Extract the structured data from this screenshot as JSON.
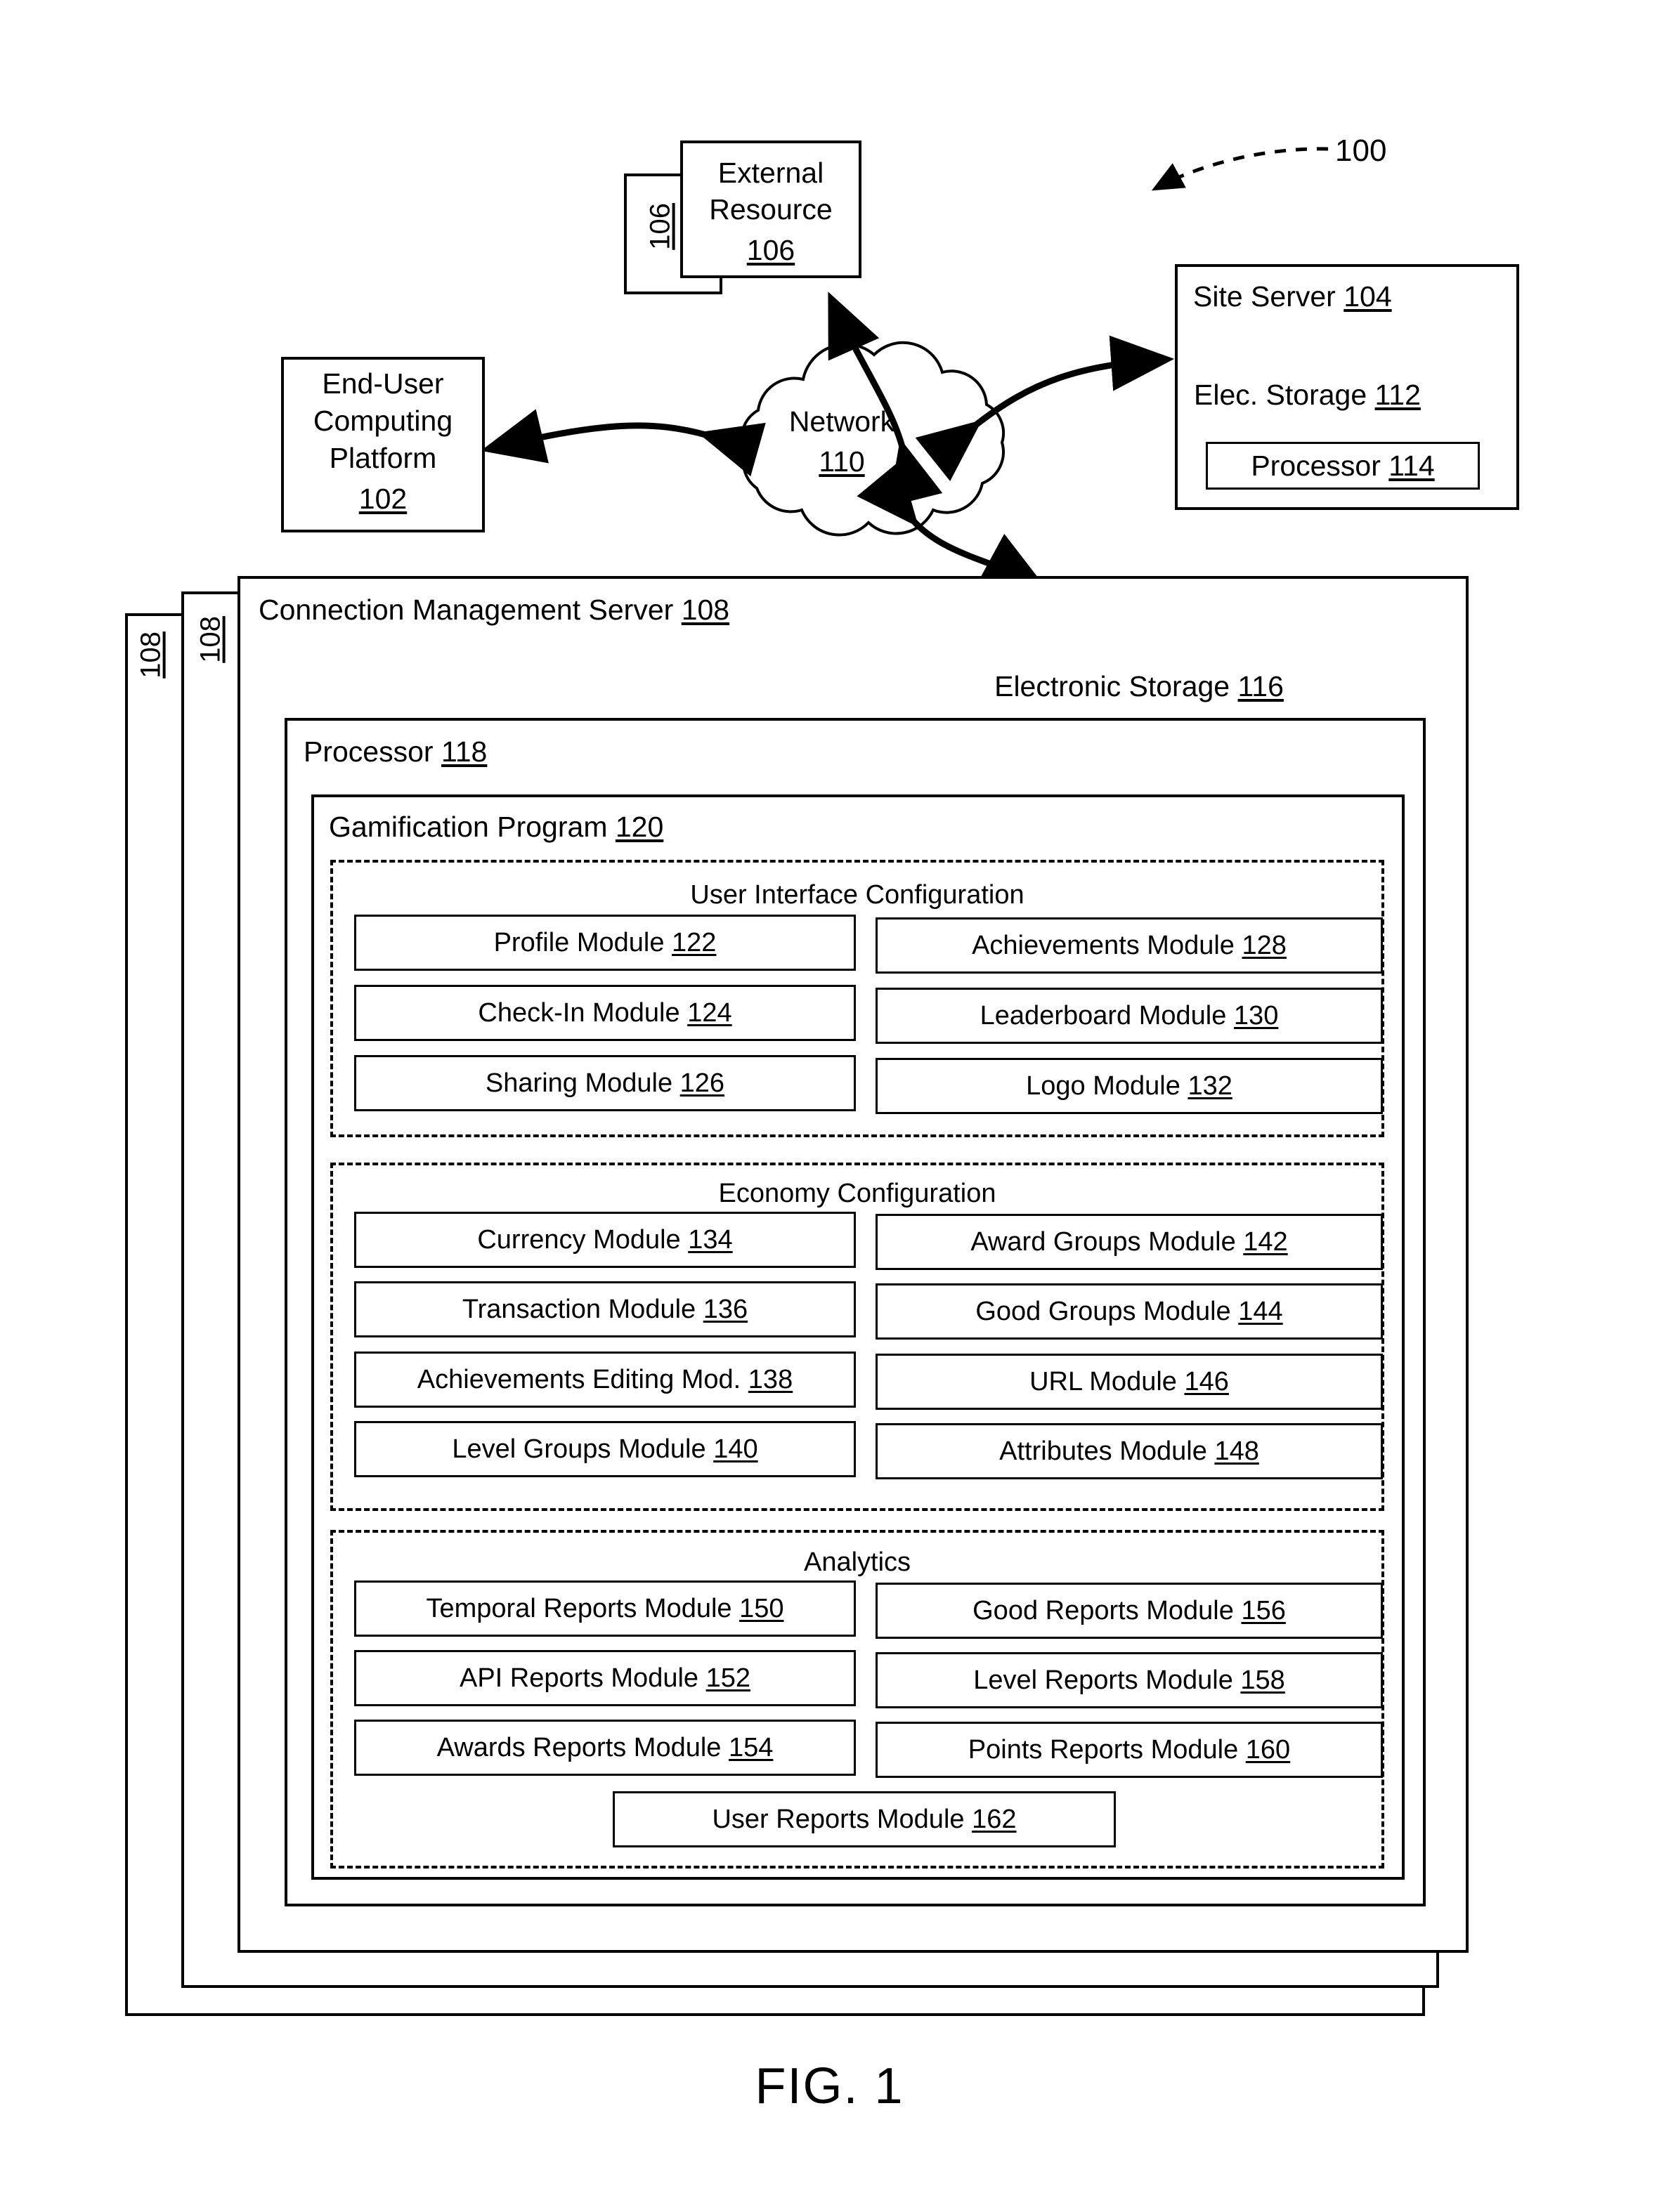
{
  "figure": {
    "caption": "FIG. 1",
    "system_ref": "100"
  },
  "nodes": {
    "external_resource": {
      "label": "External",
      "label2": "Resource",
      "ref": "106",
      "stack_ref": "106"
    },
    "end_user_platform": {
      "line1": "End-User",
      "line2": "Computing",
      "line3": "Platform",
      "ref": "102"
    },
    "network": {
      "label": "Network",
      "ref": "110"
    },
    "site_server": {
      "title": "Site Server",
      "ref": "104",
      "storage_label": "Elec. Storage",
      "storage_ref": "112",
      "processor_label": "Processor",
      "processor_ref": "114"
    },
    "connection_management_server": {
      "title": "Connection Management Server",
      "ref": "108",
      "stack_ref_1": "108",
      "stack_ref_2": "108",
      "storage_label": "Electronic Storage",
      "storage_ref": "116",
      "processor_label": "Processor",
      "processor_ref": "118",
      "program_label": "Gamification Program",
      "program_ref": "120"
    }
  },
  "sections": [
    {
      "title": "User Interface Configuration",
      "left_modules": [
        {
          "label": "Profile Module",
          "ref": "122"
        },
        {
          "label": "Check-In Module",
          "ref": "124"
        },
        {
          "label": "Sharing Module",
          "ref": "126"
        }
      ],
      "right_modules": [
        {
          "label": "Achievements Module",
          "ref": "128"
        },
        {
          "label": "Leaderboard Module",
          "ref": "130"
        },
        {
          "label": "Logo Module",
          "ref": "132"
        }
      ],
      "full_modules": []
    },
    {
      "title": "Economy Configuration",
      "left_modules": [
        {
          "label": "Currency Module",
          "ref": "134"
        },
        {
          "label": "Transaction Module",
          "ref": "136"
        },
        {
          "label": "Achievements Editing Mod.",
          "ref": "138"
        },
        {
          "label": "Level Groups Module",
          "ref": "140"
        }
      ],
      "right_modules": [
        {
          "label": "Award Groups Module",
          "ref": "142"
        },
        {
          "label": "Good Groups Module",
          "ref": "144"
        },
        {
          "label": "URL Module",
          "ref": "146"
        },
        {
          "label": "Attributes Module",
          "ref": "148"
        }
      ],
      "full_modules": []
    },
    {
      "title": "Analytics",
      "left_modules": [
        {
          "label": "Temporal Reports Module",
          "ref": "150"
        },
        {
          "label": "API Reports Module",
          "ref": "152"
        },
        {
          "label": "Awards Reports Module",
          "ref": "154"
        }
      ],
      "right_modules": [
        {
          "label": "Good Reports Module",
          "ref": "156"
        },
        {
          "label": "Level Reports Module",
          "ref": "158"
        },
        {
          "label": "Points Reports Module",
          "ref": "160"
        }
      ],
      "full_modules": [
        {
          "label": "User Reports Module",
          "ref": "162"
        }
      ]
    }
  ],
  "colors": {
    "stroke": "#000000",
    "background": "#ffffff"
  }
}
